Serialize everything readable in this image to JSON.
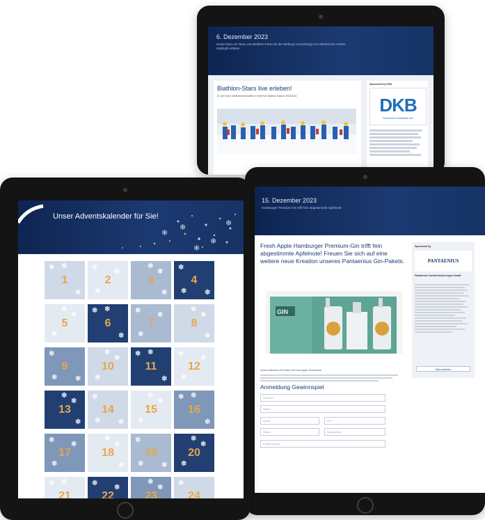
{
  "tablet_back": {
    "header_date": "6. Dezember 2023",
    "header_sub": "Heute kann ein Team von Biathlon-Fans bei der Weltcup-Ausrichtung von Oberhof ein echtes Highlight erleben",
    "article_title": "Biathlon-Stars live erleben!",
    "article_body": "Zu den Team-Weltmeisterschaften in Oberhof, Biathlon-Saison 2023/2024",
    "sponsor_label": "Sponsored by DKB",
    "sponsor_logo": "DKB",
    "sponsor_name": "Deutsche Kreditbank AG"
  },
  "tablet_middle": {
    "header_date": "15. Dezember 2023",
    "header_sub": "Hamburger Premium-Gin trifft fein abgestimmte Apfelnote",
    "headline": "Fresh Apple Hamburger Premium-Gin trifft fein abgestimmte Apfelnote! Freuen Sie sich auf eine weitere neue Kreation unseres Pantaenius Gin-Pakets.",
    "product_box_text": "GIN",
    "body_text": "Unser exklusives Gin-Paket mit Fresh Apple Geschmack",
    "sponsor_label": "Sponsored by",
    "sponsor_logo": "PANTAENIUS",
    "sponsor_name": "Pantaenius Yachtversicherungen GmbH",
    "sponsor_button": "Mehr erfahren",
    "form_title": "Anmeldung Gewinnspiel",
    "fields": [
      "Vorname*",
      "Name*",
      "Anrede",
      "PLZ",
      "Straße",
      "Hausnummer",
      "E-Mail-Adresse"
    ]
  },
  "tablet_front": {
    "title": "Unser Adventskalender für Sie!",
    "doors": [
      {
        "n": "1",
        "tone": "light"
      },
      {
        "n": "2",
        "tone": "pale"
      },
      {
        "n": "3",
        "tone": "mid"
      },
      {
        "n": "4",
        "tone": "dark"
      },
      {
        "n": "5",
        "tone": "pale"
      },
      {
        "n": "6",
        "tone": "dark"
      },
      {
        "n": "7",
        "tone": "mid"
      },
      {
        "n": "8",
        "tone": "light"
      },
      {
        "n": "9",
        "tone": "steel"
      },
      {
        "n": "10",
        "tone": "light"
      },
      {
        "n": "11",
        "tone": "dark"
      },
      {
        "n": "12",
        "tone": "pale"
      },
      {
        "n": "13",
        "tone": "dark"
      },
      {
        "n": "14",
        "tone": "light"
      },
      {
        "n": "15",
        "tone": "pale"
      },
      {
        "n": "16",
        "tone": "steel"
      },
      {
        "n": "17",
        "tone": "steel"
      },
      {
        "n": "18",
        "tone": "pale"
      },
      {
        "n": "19",
        "tone": "mid"
      },
      {
        "n": "20",
        "tone": "dark"
      },
      {
        "n": "21",
        "tone": "pale"
      },
      {
        "n": "22",
        "tone": "dark"
      },
      {
        "n": "23",
        "tone": "steel"
      },
      {
        "n": "24",
        "tone": "light"
      }
    ]
  },
  "colors": {
    "navy": "#1c3a72",
    "gold": "#e8a64a",
    "dkb_blue": "#1e6fb8",
    "gin_green": "#5fa596"
  }
}
